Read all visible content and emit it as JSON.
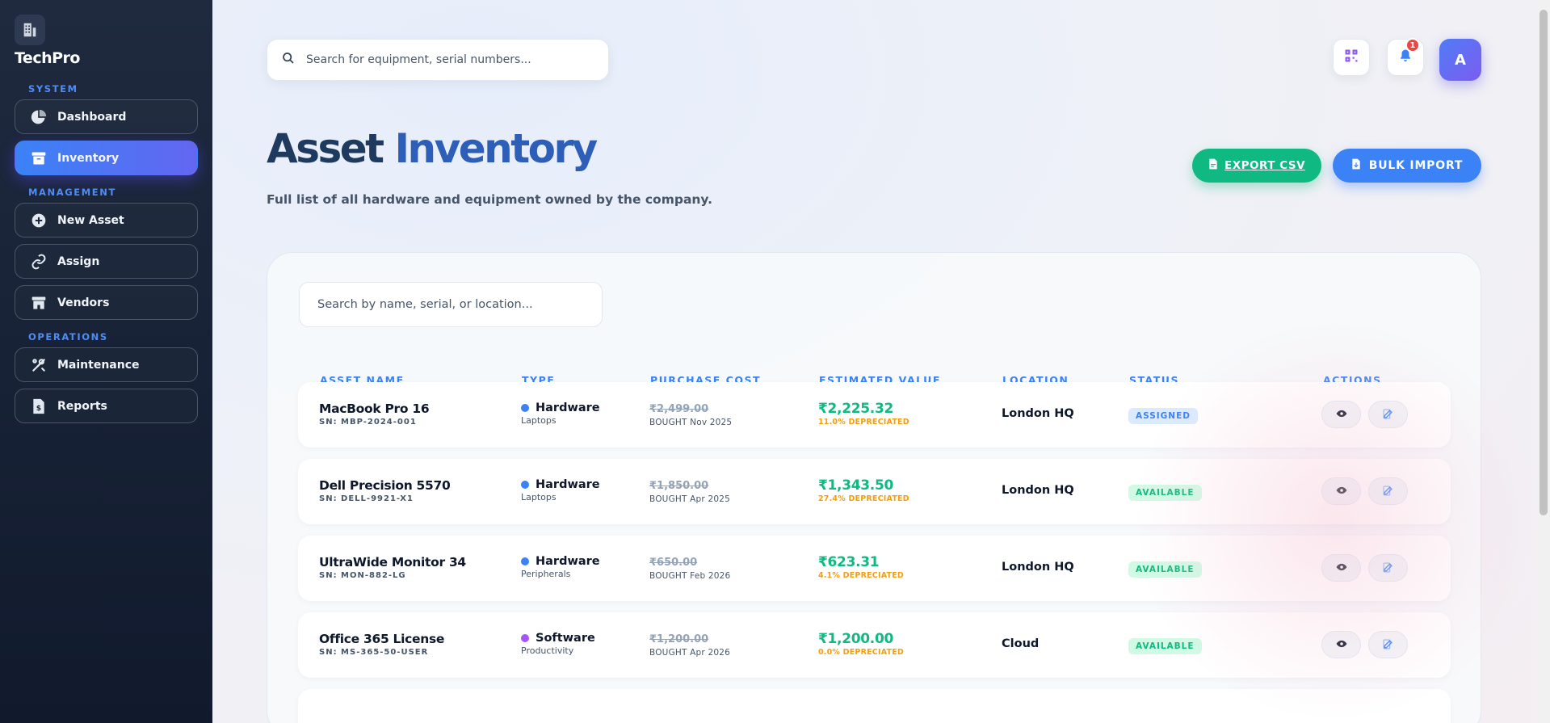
{
  "brand": {
    "name": "TechPro"
  },
  "sidebar": {
    "sections": [
      {
        "label": "SYSTEM",
        "items": [
          {
            "label": "Dashboard",
            "icon": "pie-chart-icon"
          },
          {
            "label": "Inventory",
            "icon": "archive-box-icon",
            "active": true
          }
        ]
      },
      {
        "label": "MANAGEMENT",
        "items": [
          {
            "label": "New Asset",
            "icon": "plus-circle-icon"
          },
          {
            "label": "Assign",
            "icon": "link-icon"
          }
        ]
      },
      {
        "label": "",
        "items": [
          {
            "label": "Vendors",
            "icon": "store-icon"
          }
        ]
      },
      {
        "label": "OPERATIONS",
        "items": [
          {
            "label": "Maintenance",
            "icon": "tools-icon"
          },
          {
            "label": "Reports",
            "icon": "invoice-icon"
          }
        ]
      }
    ]
  },
  "topbar": {
    "search_placeholder": "Search for equipment, serial numbers...",
    "notification_count": "1",
    "avatar_initial": "A"
  },
  "page": {
    "title_part1": "Asset",
    "title_part2": "Inventory",
    "subtitle": "Full list of all hardware and equipment owned by the company.",
    "export_label": "EXPORT CSV",
    "import_label": "BULK IMPORT"
  },
  "table": {
    "search_placeholder": "Search by name, serial, or location...",
    "headers": [
      "ASSET NAME",
      "TYPE",
      "PURCHASE COST",
      "ESTIMATED VALUE",
      "LOCATION",
      "STATUS",
      "ACTIONS"
    ],
    "rows": [
      {
        "name": "MacBook Pro 16",
        "sn": "SN: MBP-2024-001",
        "type": "Hardware",
        "type_color": "#3b82f6",
        "subtype": "Laptops",
        "cost": "₹2,499.00",
        "bought": "BOUGHT Nov 2025",
        "value": "₹2,225.32",
        "depreciated": "11.0% DEPRECIATED",
        "location": "London HQ",
        "status": "ASSIGNED"
      },
      {
        "name": "Dell Precision 5570",
        "sn": "SN: DELL-9921-X1",
        "type": "Hardware",
        "type_color": "#3b82f6",
        "subtype": "Laptops",
        "cost": "₹1,850.00",
        "bought": "BOUGHT Apr 2025",
        "value": "₹1,343.50",
        "depreciated": "27.4% DEPRECIATED",
        "location": "London HQ",
        "status": "AVAILABLE"
      },
      {
        "name": "UltraWide Monitor 34",
        "sn": "SN: MON-882-LG",
        "type": "Hardware",
        "type_color": "#3b82f6",
        "subtype": "Peripherals",
        "cost": "₹650.00",
        "bought": "BOUGHT Feb 2026",
        "value": "₹623.31",
        "depreciated": "4.1% DEPRECIATED",
        "location": "London HQ",
        "status": "AVAILABLE"
      },
      {
        "name": "Office 365 License",
        "sn": "SN: MS-365-50-USER",
        "type": "Software",
        "type_color": "#a855f7",
        "subtype": "Productivity",
        "cost": "₹1,200.00",
        "bought": "BOUGHT Apr 2026",
        "value": "₹1,200.00",
        "depreciated": "0.0% DEPRECIATED",
        "location": "Cloud",
        "status": "AVAILABLE"
      }
    ]
  }
}
